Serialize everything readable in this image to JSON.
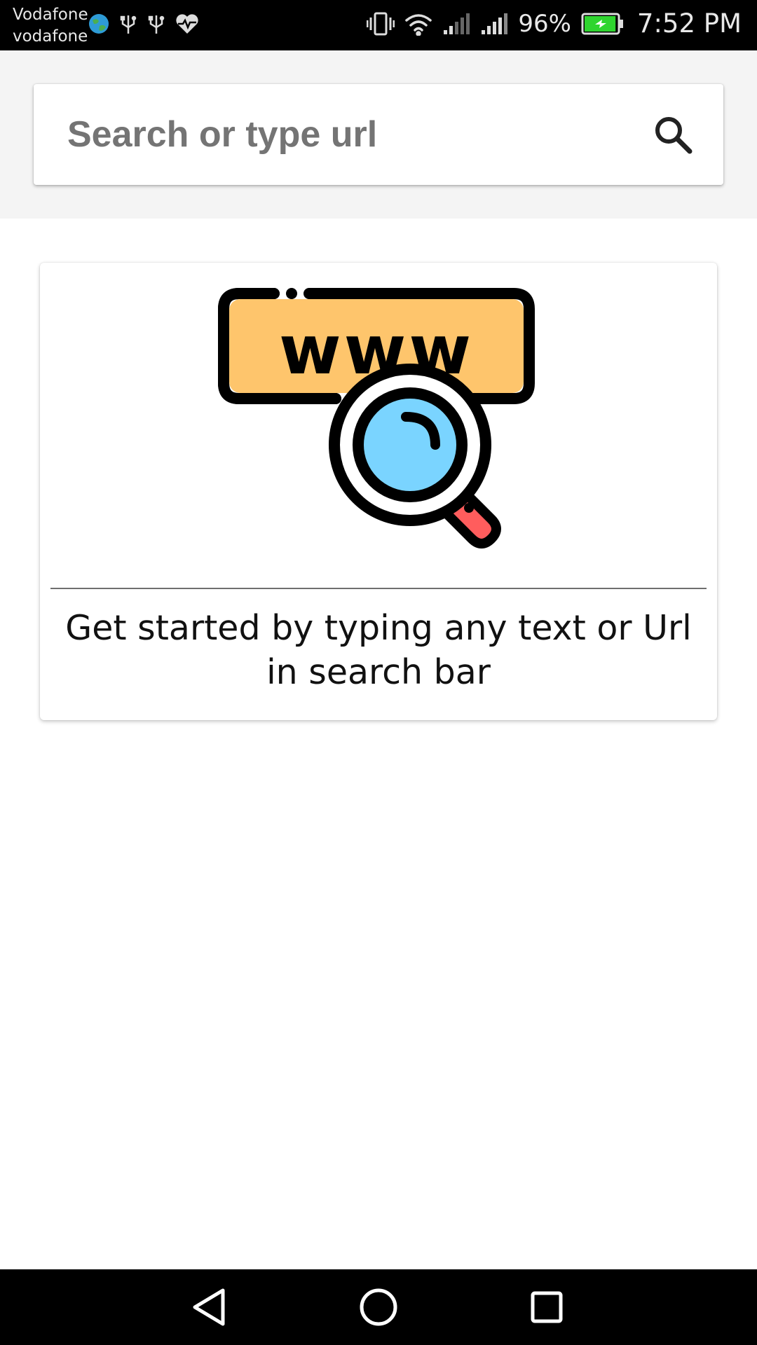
{
  "status_bar": {
    "carrier_primary": "Vodafone",
    "carrier_secondary": "vodafone",
    "battery_percent": "96%",
    "battery_level": 0.96,
    "time": "7:52 PM",
    "icons": [
      "globe-icon",
      "usb-icon",
      "usb-icon",
      "heart-pulse-icon",
      "vibrate-icon",
      "wifi-icon",
      "signal-icon",
      "signal-icon",
      "battery-charging-icon"
    ]
  },
  "search": {
    "placeholder": "Search or type url",
    "icon": "search-icon"
  },
  "card": {
    "illustration_label": "www",
    "message": "Get started by typing any text or Url in search bar",
    "colors": {
      "banner": "#FEC56C",
      "lens": "#7AD4FF",
      "handle": "#FF5D5D",
      "outline": "#000000"
    }
  },
  "nav_bar": {
    "buttons": [
      "back-icon",
      "home-icon",
      "recents-icon"
    ]
  }
}
